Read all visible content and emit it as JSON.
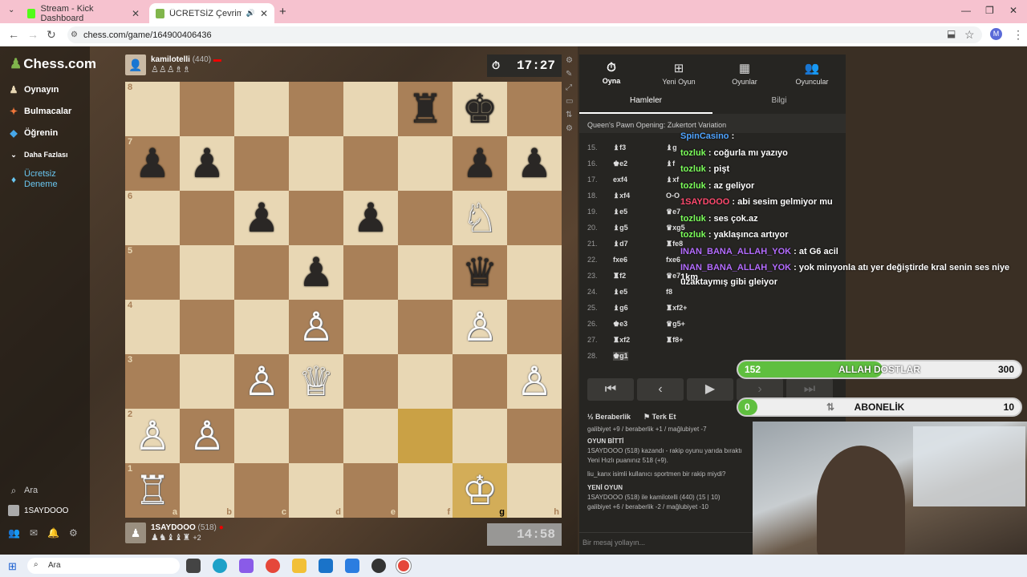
{
  "browser": {
    "tabs": [
      {
        "label": "Stream - Kick Dashboard"
      },
      {
        "label": "ÜCRETSİZ Çevrimiçi Satranç"
      }
    ],
    "new_tab": "+",
    "url": "chess.com/game/164900406436",
    "profile_initial": "M"
  },
  "sidebar": {
    "logo": "Chess.com",
    "items": [
      {
        "label": "Oynayın"
      },
      {
        "label": "Bulmacalar"
      },
      {
        "label": "Öğrenin"
      },
      {
        "label": "Daha Fazlası"
      },
      {
        "label": "Ücretsiz Deneme"
      }
    ],
    "search": "Ara",
    "user": "1SAYDOOO"
  },
  "top_player": {
    "name": "kamilotelli",
    "rating": "(440)",
    "clock": "17:27"
  },
  "bottom_player": {
    "name": "1SAYDOOO",
    "rating": "(518)",
    "extra": "+2",
    "clock": "14:58"
  },
  "board": {
    "ranks": [
      "8",
      "7",
      "6",
      "5",
      "4",
      "3",
      "2",
      "1"
    ],
    "files": [
      "a",
      "b",
      "c",
      "d",
      "e",
      "f",
      "g",
      "h"
    ],
    "position": [
      [
        "",
        "",
        "",
        "",
        "",
        "♜",
        "♚",
        ""
      ],
      [
        "♟",
        "♟",
        "",
        "",
        "",
        "",
        "♟",
        "♟"
      ],
      [
        "",
        "",
        "♟",
        "",
        "♟",
        "",
        "♘",
        ""
      ],
      [
        "",
        "",
        "",
        "♟",
        "",
        "",
        "♛",
        ""
      ],
      [
        "",
        "",
        "",
        "♙",
        "",
        "",
        "♙",
        ""
      ],
      [
        "",
        "",
        "♙",
        "♕",
        "",
        "",
        "",
        "♙"
      ],
      [
        "♙",
        "♙",
        "",
        "",
        "",
        "",
        "",
        ""
      ],
      [
        "♖",
        "",
        "",
        "",
        "",
        "",
        "♔",
        ""
      ]
    ]
  },
  "right_panel": {
    "tabs": [
      "Oyna",
      "Yeni Oyun",
      "Oyunlar",
      "Oyuncular"
    ],
    "subtabs": [
      "Hamleler",
      "Bilgi"
    ],
    "opening": "Queen's Pawn Opening: Zukertort Variation",
    "moves": [
      {
        "n": "15.",
        "w": "♝f3",
        "b": "♝g"
      },
      {
        "n": "16.",
        "w": "♚e2",
        "b": "♝f"
      },
      {
        "n": "17.",
        "w": "exf4",
        "b": "♝xf"
      },
      {
        "n": "18.",
        "w": "♝xf4",
        "b": "O-O"
      },
      {
        "n": "19.",
        "w": "♝e5",
        "b": "♛e7"
      },
      {
        "n": "20.",
        "w": "♝g5",
        "b": "♛xg5"
      },
      {
        "n": "21.",
        "w": "♝d7",
        "b": "♜fe8"
      },
      {
        "n": "22.",
        "w": "fxe6",
        "b": "fxe6"
      },
      {
        "n": "23.",
        "w": "♜f2",
        "b": "♛e7"
      },
      {
        "n": "24.",
        "w": "♝e5",
        "b": "f8"
      },
      {
        "n": "25.",
        "w": "♝g6",
        "b": "♜xf2+"
      },
      {
        "n": "26.",
        "w": "♚e3",
        "b": "♛g5+"
      },
      {
        "n": "27.",
        "w": "♜xf2",
        "b": "♜f8+"
      },
      {
        "n": "28.",
        "w": "♚g1",
        "b": ""
      }
    ],
    "draw": "Beraberlik",
    "resign": "Terk Et",
    "log": [
      "galibiyet +9 / beraberlik +1 / mağlubiyet -7",
      "OYUN BİTTİ",
      "1SAYDOOO (518) kazandı - rakip oyunu yarıda bıraktı",
      "Yeni Hızlı puanınız 518 (+9).",
      "liu_kanx isimli kullanıcı sportmen bir rakip miydi?",
      "YENİ OYUN",
      "1SAYDOOO (518) ile kamilotelli (440) (15 | 10)",
      "galibiyet +6 / beraberlik -2 / mağlubiyet -10"
    ],
    "message_placeholder": "Bir mesaj yollayın..."
  },
  "chat": [
    {
      "user": "SpinCasino",
      "text": " : ",
      "color": "#4fa3ff"
    },
    {
      "user": "tozluk",
      "text": " : coğurla mı yazıyo",
      "color": "#7cff5b"
    },
    {
      "user": "tozluk",
      "text": " : pişt",
      "color": "#7cff5b"
    },
    {
      "user": "tozluk",
      "text": " : az geliyor",
      "color": "#7cff5b"
    },
    {
      "user": "1SAYDOOO",
      "text": " : abi sesim gelmiyor mu",
      "color": "#ff4a6e"
    },
    {
      "user": "tozluk",
      "text": " : ses çok.az",
      "color": "#7cff5b"
    },
    {
      "user": "tozluk",
      "text": " : yaklaşınca artıyor",
      "color": "#7cff5b"
    },
    {
      "user": "INAN_BANA_ALLAH_YOK",
      "text": " : at G6 acil",
      "color": "#b46cff"
    },
    {
      "user": "INAN_BANA_ALLAH_YOK",
      "text": " : yok minyonla atı yer değiştirde kral senin ses niye 1km",
      "color": "#b46cff"
    },
    {
      "user": "",
      "text": "uzaktaymış gibi gleiyor",
      "color": "#ffffff"
    }
  ],
  "goals": [
    {
      "current": "152",
      "label": "ALLAH DOSTLAR",
      "target": "300",
      "progress": 0.51
    },
    {
      "current": "0",
      "label": "ABONELİK",
      "target": "10",
      "progress": 0.0
    }
  ],
  "taskbar": {
    "search": "Ara"
  }
}
